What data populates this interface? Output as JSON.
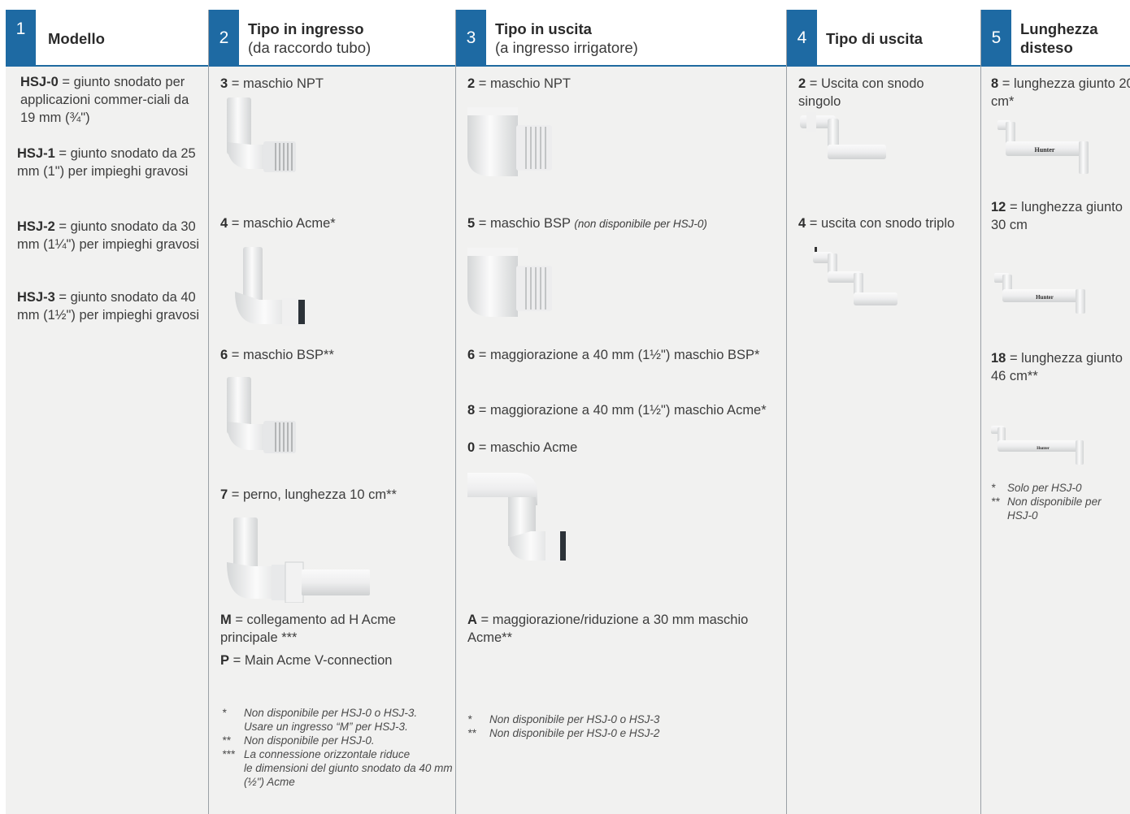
{
  "columns": [
    {
      "num": "1",
      "title": "Modello",
      "items": [
        {
          "code": "HSJ-0",
          "text": " = giunto snodato per applicazioni commer-ciali da 19 mm (¾\")"
        },
        {
          "code": "HSJ-1",
          "text": " = giunto snodato da 25 mm (1\") per impieghi gravosi"
        },
        {
          "code": "HSJ-2",
          "text": " = giunto snodato da 30 mm (1¼\") per impieghi gravosi"
        },
        {
          "code": "HSJ-3",
          "text": " = giunto snodato da 40 mm (1½\") per impieghi gravosi"
        }
      ]
    },
    {
      "num": "2",
      "title": "Tipo in ingresso",
      "subtitle": "(da raccordo tubo)",
      "items": [
        {
          "code": "3",
          "text": " = maschio NPT"
        },
        {
          "code": "4",
          "text": " = maschio Acme*"
        },
        {
          "code": "6",
          "text": " = maschio BSP**"
        },
        {
          "code": "7",
          "text": " = perno, lunghezza 10 cm**"
        },
        {
          "code": "M",
          "text": "  = collegamento ad H Acme principale ***"
        },
        {
          "code": "P",
          "text": "  = Main Acme V-connection"
        }
      ],
      "footnotes": [
        {
          "mark": "*",
          "text": "Non disponibile per HSJ-0 o HSJ-3.",
          "cont": "Usare un ingresso “M” per HSJ-3."
        },
        {
          "mark": "**",
          "text": "Non disponibile per HSJ-0."
        },
        {
          "mark": "***",
          "text": "La connessione orizzontale riduce",
          "cont": "le dimensioni del giunto snodato da 40 mm (½\") Acme"
        }
      ]
    },
    {
      "num": "3",
      "title": "Tipo in uscita",
      "subtitle": "(a ingresso irrigatore)",
      "items": [
        {
          "code": "2",
          "text": " = maschio NPT"
        },
        {
          "code": "5",
          "text": " = maschio BSP ",
          "note": "(non disponibile per HSJ-0)"
        },
        {
          "code": "6",
          "text": " = maggiorazione a 40 mm (1½\") maschio BSP*"
        },
        {
          "code": "8",
          "text": " = maggiorazione a 40 mm (1½\") maschio Acme*"
        },
        {
          "code": "0",
          "text": " = maschio Acme"
        },
        {
          "code": "A",
          "text": " = maggiorazione/riduzione a 30 mm maschio Acme**"
        }
      ],
      "footnotes": [
        {
          "mark": "*",
          "text": "Non disponibile per HSJ-0 o HSJ-3"
        },
        {
          "mark": "**",
          "text": "Non disponibile per HSJ-0 e HSJ-2"
        }
      ]
    },
    {
      "num": "4",
      "title": "Tipo di uscita",
      "items": [
        {
          "code": "2",
          "text": " = Uscita con snodo singolo"
        },
        {
          "code": "4",
          "text": " = uscita con snodo triplo"
        }
      ]
    },
    {
      "num": "5",
      "title": "Lunghezza disteso",
      "items": [
        {
          "code": "8",
          "text": " = lunghezza giunto 20 cm*"
        },
        {
          "code": "12",
          "text": "  = lunghezza giunto 30 cm"
        },
        {
          "code": "18",
          "text": "  = lunghezza giunto 46 cm**"
        }
      ],
      "logo_text": "Hunter",
      "footnotes": [
        {
          "mark": "*",
          "text": "Solo per HSJ-0"
        },
        {
          "mark": "**",
          "text": "Non disponibile per",
          "cont": "HSJ-0"
        }
      ]
    }
  ],
  "colors": {
    "accent": "#1e6aa3",
    "panel": "#f1f1f0",
    "part": "#e9eaea"
  }
}
